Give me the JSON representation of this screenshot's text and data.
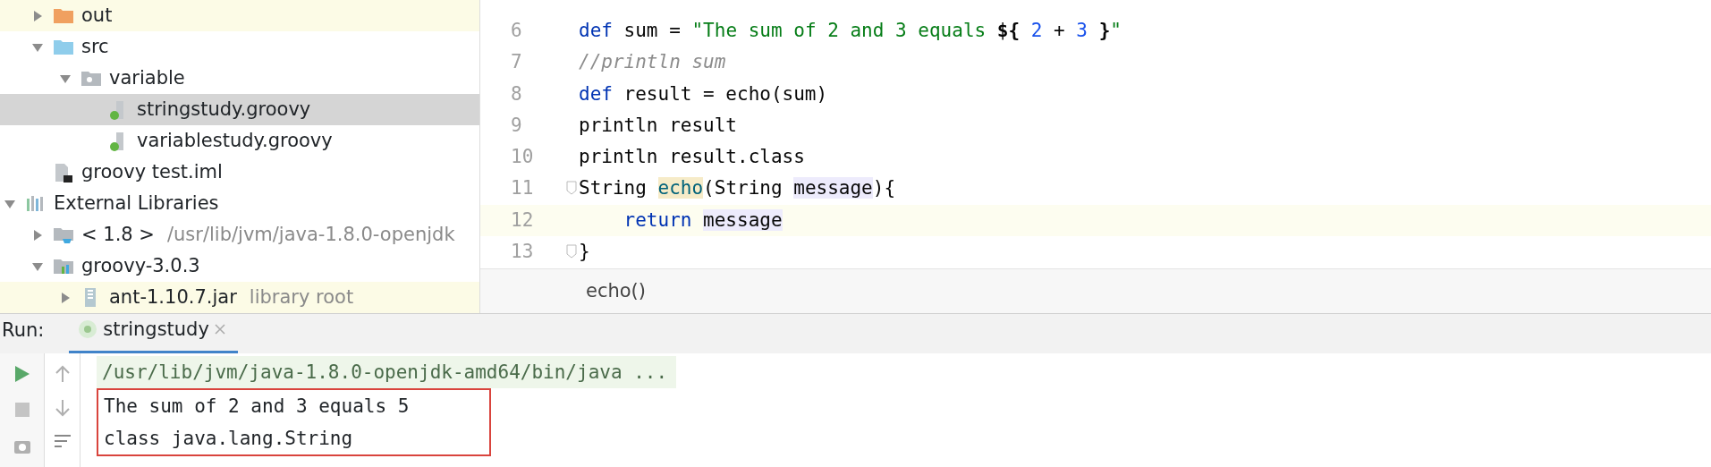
{
  "project_tree": {
    "items": [
      {
        "label": "out",
        "kind": "folder-orange",
        "expanded": false,
        "selected": false,
        "tinted": true
      },
      {
        "label": "src",
        "kind": "folder-blue",
        "expanded": true,
        "selected": false,
        "tinted": false,
        "children": [
          {
            "label": "variable",
            "kind": "package",
            "expanded": true,
            "selected": false,
            "tinted": false,
            "children": [
              {
                "label": "stringstudy.groovy",
                "kind": "groovy-file",
                "selected": true,
                "tinted": false
              },
              {
                "label": "variablestudy.groovy",
                "kind": "groovy-file",
                "selected": false,
                "tinted": false
              }
            ]
          }
        ]
      },
      {
        "label": "groovy test.iml",
        "kind": "iml-file",
        "selected": false,
        "tinted": false
      }
    ],
    "external_libraries": {
      "label": "External Libraries",
      "kind": "libraries",
      "expanded": true,
      "selected": false,
      "tinted": false,
      "children": [
        {
          "label": "< 1.8 >",
          "hint": "/usr/lib/jvm/java-1.8.0-openjdk",
          "kind": "jdk",
          "expanded": false,
          "selected": false,
          "tinted": false
        },
        {
          "label": "groovy-3.0.3",
          "kind": "library",
          "expanded": true,
          "selected": false,
          "tinted": false,
          "children": [
            {
              "label": "ant-1.10.7.jar",
              "hint": "library root",
              "kind": "jar",
              "expanded": false,
              "selected": false,
              "tinted": true
            }
          ]
        }
      ]
    }
  },
  "editor": {
    "lines": [
      {
        "number": "6",
        "current": false,
        "tokens": [
          {
            "text": "def",
            "kind": "keyword"
          },
          {
            "text": " sum = ",
            "kind": "plain"
          },
          {
            "text": "\"The sum of 2 and 3 equals ",
            "kind": "string"
          },
          {
            "text": "${",
            "kind": "brace"
          },
          {
            "text": " 2",
            "kind": "number"
          },
          {
            "text": " + ",
            "kind": "plain"
          },
          {
            "text": "3",
            "kind": "number"
          },
          {
            "text": " }",
            "kind": "brace"
          },
          {
            "text": "\"",
            "kind": "string"
          }
        ]
      },
      {
        "number": "7",
        "current": false,
        "tokens": [
          {
            "text": "//println sum",
            "kind": "comment"
          }
        ]
      },
      {
        "number": "8",
        "current": false,
        "tokens": [
          {
            "text": "def",
            "kind": "keyword"
          },
          {
            "text": " result = echo(sum)",
            "kind": "plain"
          }
        ]
      },
      {
        "number": "9",
        "current": false,
        "tokens": [
          {
            "text": "println result",
            "kind": "plain"
          }
        ]
      },
      {
        "number": "10",
        "current": false,
        "tokens": [
          {
            "text": "println result.class",
            "kind": "plain"
          }
        ]
      },
      {
        "number": "11",
        "current": false,
        "fold": true,
        "tokens": [
          {
            "text": "String ",
            "kind": "plain"
          },
          {
            "text": "echo",
            "kind": "method-highlight"
          },
          {
            "text": "(String ",
            "kind": "plain"
          },
          {
            "text": "message",
            "kind": "param-highlight"
          },
          {
            "text": "){",
            "kind": "plain"
          }
        ]
      },
      {
        "number": "12",
        "current": true,
        "tokens": [
          {
            "text": "    return ",
            "kind": "keyword"
          },
          {
            "text": "message",
            "kind": "param-highlight"
          }
        ]
      },
      {
        "number": "13",
        "current": false,
        "fold": true,
        "tokens": [
          {
            "text": "}",
            "kind": "plain"
          }
        ]
      }
    ],
    "breadcrumb": "echo()"
  },
  "run_panel": {
    "label": "Run:",
    "tabs": [
      {
        "label": "stringstudy",
        "selected": true
      }
    ],
    "console": [
      {
        "text": "/usr/lib/jvm/java-1.8.0-openjdk-amd64/bin/java ...",
        "kind": "command",
        "boxed": false
      },
      {
        "text": "The sum of 2 and 3 equals 5",
        "kind": "output",
        "boxed": true
      },
      {
        "text": "class java.lang.String",
        "kind": "output",
        "boxed": true
      }
    ]
  }
}
